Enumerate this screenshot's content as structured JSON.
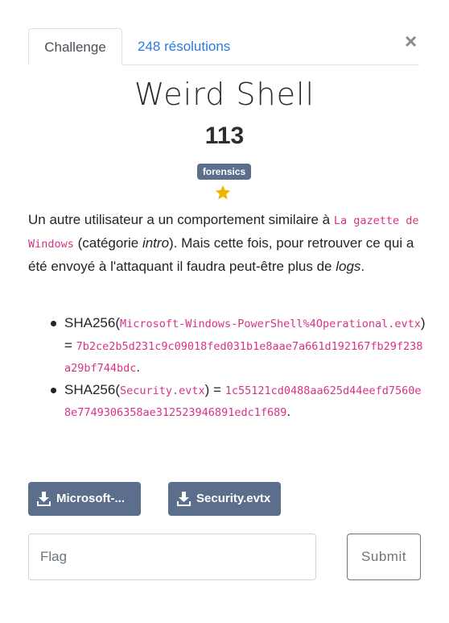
{
  "tabs": {
    "challenge": "Challenge",
    "solves": "248 résolutions"
  },
  "close_symbol": "×",
  "challenge": {
    "name": "Weird Shell",
    "points": "113",
    "category": "forensics",
    "star_icon": "star-icon"
  },
  "description": {
    "part1": "Un autre utilisateur a un comportement similaire à ",
    "code1": "La gazette de Windows",
    "part2": " (catégorie ",
    "em1": "intro",
    "part3": "). Mais cette fois, pour retrouver ce qui a été envoyé à l'attaquant il faudra peut-être plus de ",
    "em2": "logs",
    "part4": "."
  },
  "hashes": [
    {
      "prefix": "SHA256(",
      "file": "Microsoft-Windows-PowerShell%4Operational.evtx",
      "mid": ") = ",
      "hash": "7b2ce2b5d231c9c09018fed031b1e8aae7a661d192167fb29f238a29bf744bdc",
      "suffix": "."
    },
    {
      "prefix": "SHA256(",
      "file": "Security.evtx",
      "mid": ") = ",
      "hash": "1c55121cd0488aa625d44eefd7560e8e7749306358ae312523946891edc1f689",
      "suffix": "."
    }
  ],
  "downloads": [
    {
      "label": "Microsoft-...",
      "icon": "download-icon"
    },
    {
      "label": "Security.evtx",
      "icon": "download-icon"
    }
  ],
  "form": {
    "placeholder": "Flag",
    "value": "",
    "submit_label": "Submit"
  },
  "colors": {
    "badge": "#5b6e8c",
    "link": "#2a7ae2",
    "code": "#d63384",
    "star": "#f0b400"
  }
}
